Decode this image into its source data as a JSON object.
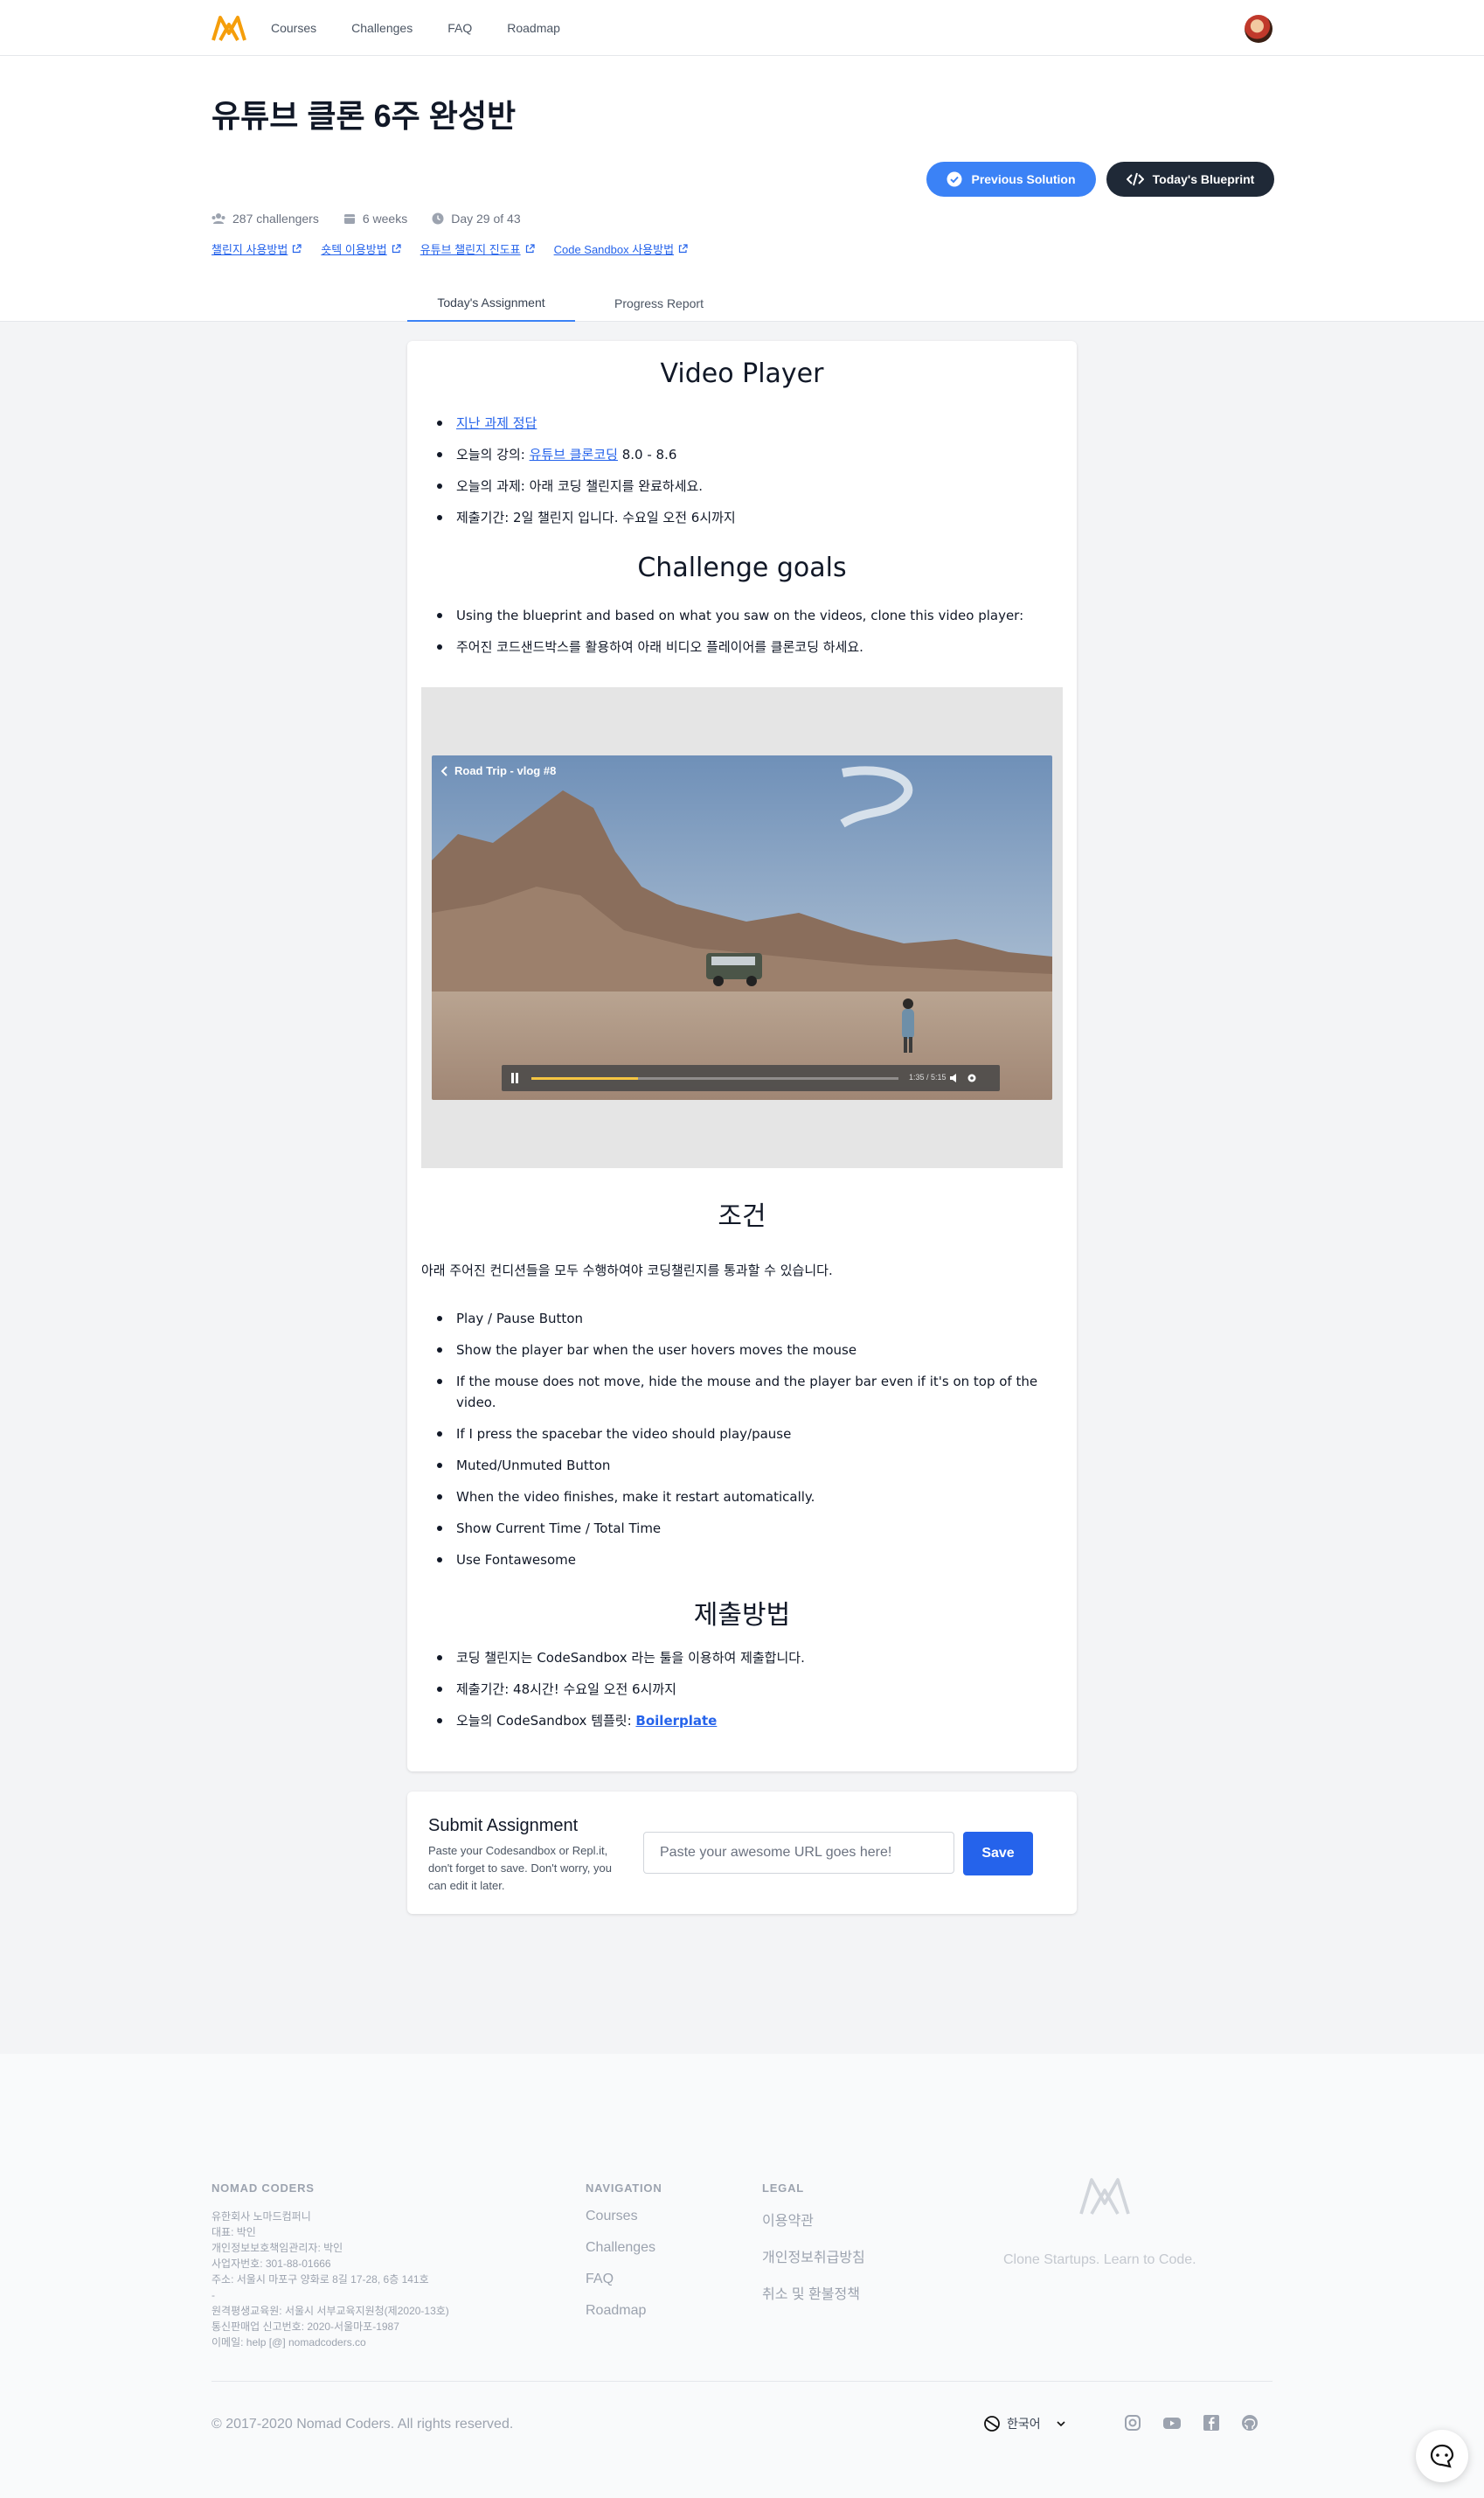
{
  "nav": {
    "links": [
      "Courses",
      "Challenges",
      "FAQ",
      "Roadmap"
    ]
  },
  "challenge": {
    "title": "유튜브 클론 6주 완성반",
    "challengers": "287 challengers",
    "duration": "6 weeks",
    "day": "Day 29 of 43",
    "links": [
      "챌린지 사용방법",
      "숏텍 이용방법",
      "유튜브 챌린지 진도표",
      "Code Sandbox 사용방법"
    ],
    "previous_solution": "Previous Solution",
    "todays_blueprint": "Today's Blueprint"
  },
  "tabs": [
    "Today's Assignment",
    "Progress Report"
  ],
  "assignment": {
    "heading": "Video Player",
    "intro": [
      {
        "link": "지난 과제 정답",
        "text": ""
      },
      {
        "pre": "오늘의 강의: ",
        "link": "유튜브 클론코딩",
        "post": " 8.0 - 8.6"
      },
      {
        "text": "오늘의 과제: 아래 코딩 챌린지를 완료하세요."
      },
      {
        "text": "제출기간: 2일 챌린지 입니다. 수요일 오전 6시까지"
      }
    ],
    "goals_heading": "Challenge goals",
    "goals": [
      "Using the blueprint and based on what you saw on the videos, clone this video player:",
      "주어진 코드샌드박스를 활용하여 아래 비디오 플레이어를 클론코딩 하세요."
    ],
    "video": {
      "title": "Road Trip - vlog #8",
      "time": "1:35 / 5:15",
      "progress": 0.29
    },
    "conditions_heading": "조건",
    "conditions_intro": "아래 주어진 컨디션들을 모두 수행하여야 코딩챌린지를 통과할 수 있습니다.",
    "conditions": [
      "Play / Pause Button",
      "Show the player bar when the user hovers moves the mouse",
      "If the mouse does not move, hide the mouse and the player bar even if it's on top of the video.",
      "If I press the spacebar the video should play/pause",
      "Muted/Unmuted Button",
      "When the video finishes, make it restart automatically.",
      "Show Current Time / Total Time",
      "Use Fontawesome"
    ],
    "submit_heading": "제출방법",
    "submit_items": [
      {
        "text": "코딩 챌린지는 CodeSandbox 라는 툴을 이용하여 제출합니다."
      },
      {
        "text": "제출기간: 48시간! 수요일 오전 6시까지"
      },
      {
        "pre": "오늘의 CodeSandbox 템플릿: ",
        "link": "Boilerplate"
      }
    ]
  },
  "submit": {
    "title": "Submit Assignment",
    "desc": "Paste your Codesandbox or Repl.it, don't forget to save. Don't worry, you can edit it later.",
    "placeholder": "Paste your awesome URL goes here!",
    "save": "Save"
  },
  "footer": {
    "company_heading": "NOMAD CODERS",
    "company_lines": [
      "유한회사 노마드컴퍼니",
      "대표: 박인",
      "개인정보보호책임관리자: 박인",
      "사업자번호: 301-88-01666",
      "주소: 서울시 마포구 양화로 8길 17-28, 6층 141호",
      "-",
      "원격평생교육원: 서울시 서부교육지원청(제2020-13호)",
      "통신판매업 신고번호: 2020-서울마포-1987",
      "이메일: help [@] nomadcoders.co"
    ],
    "nav_heading": "NAVIGATION",
    "nav_links": [
      "Courses",
      "Challenges",
      "FAQ",
      "Roadmap"
    ],
    "legal_heading": "LEGAL",
    "legal_links": [
      "이용약관",
      "개인정보취급방침",
      "취소 및 환불정책"
    ],
    "tagline": "Clone Startups. Learn to Code.",
    "copyright": "© 2017-2020 Nomad Coders. All rights reserved.",
    "language": "한국어"
  },
  "colors": {
    "accent": "#3b82f6",
    "dark_button": "#1f2937",
    "save": "#2563eb",
    "logo": "#f59e0b"
  }
}
